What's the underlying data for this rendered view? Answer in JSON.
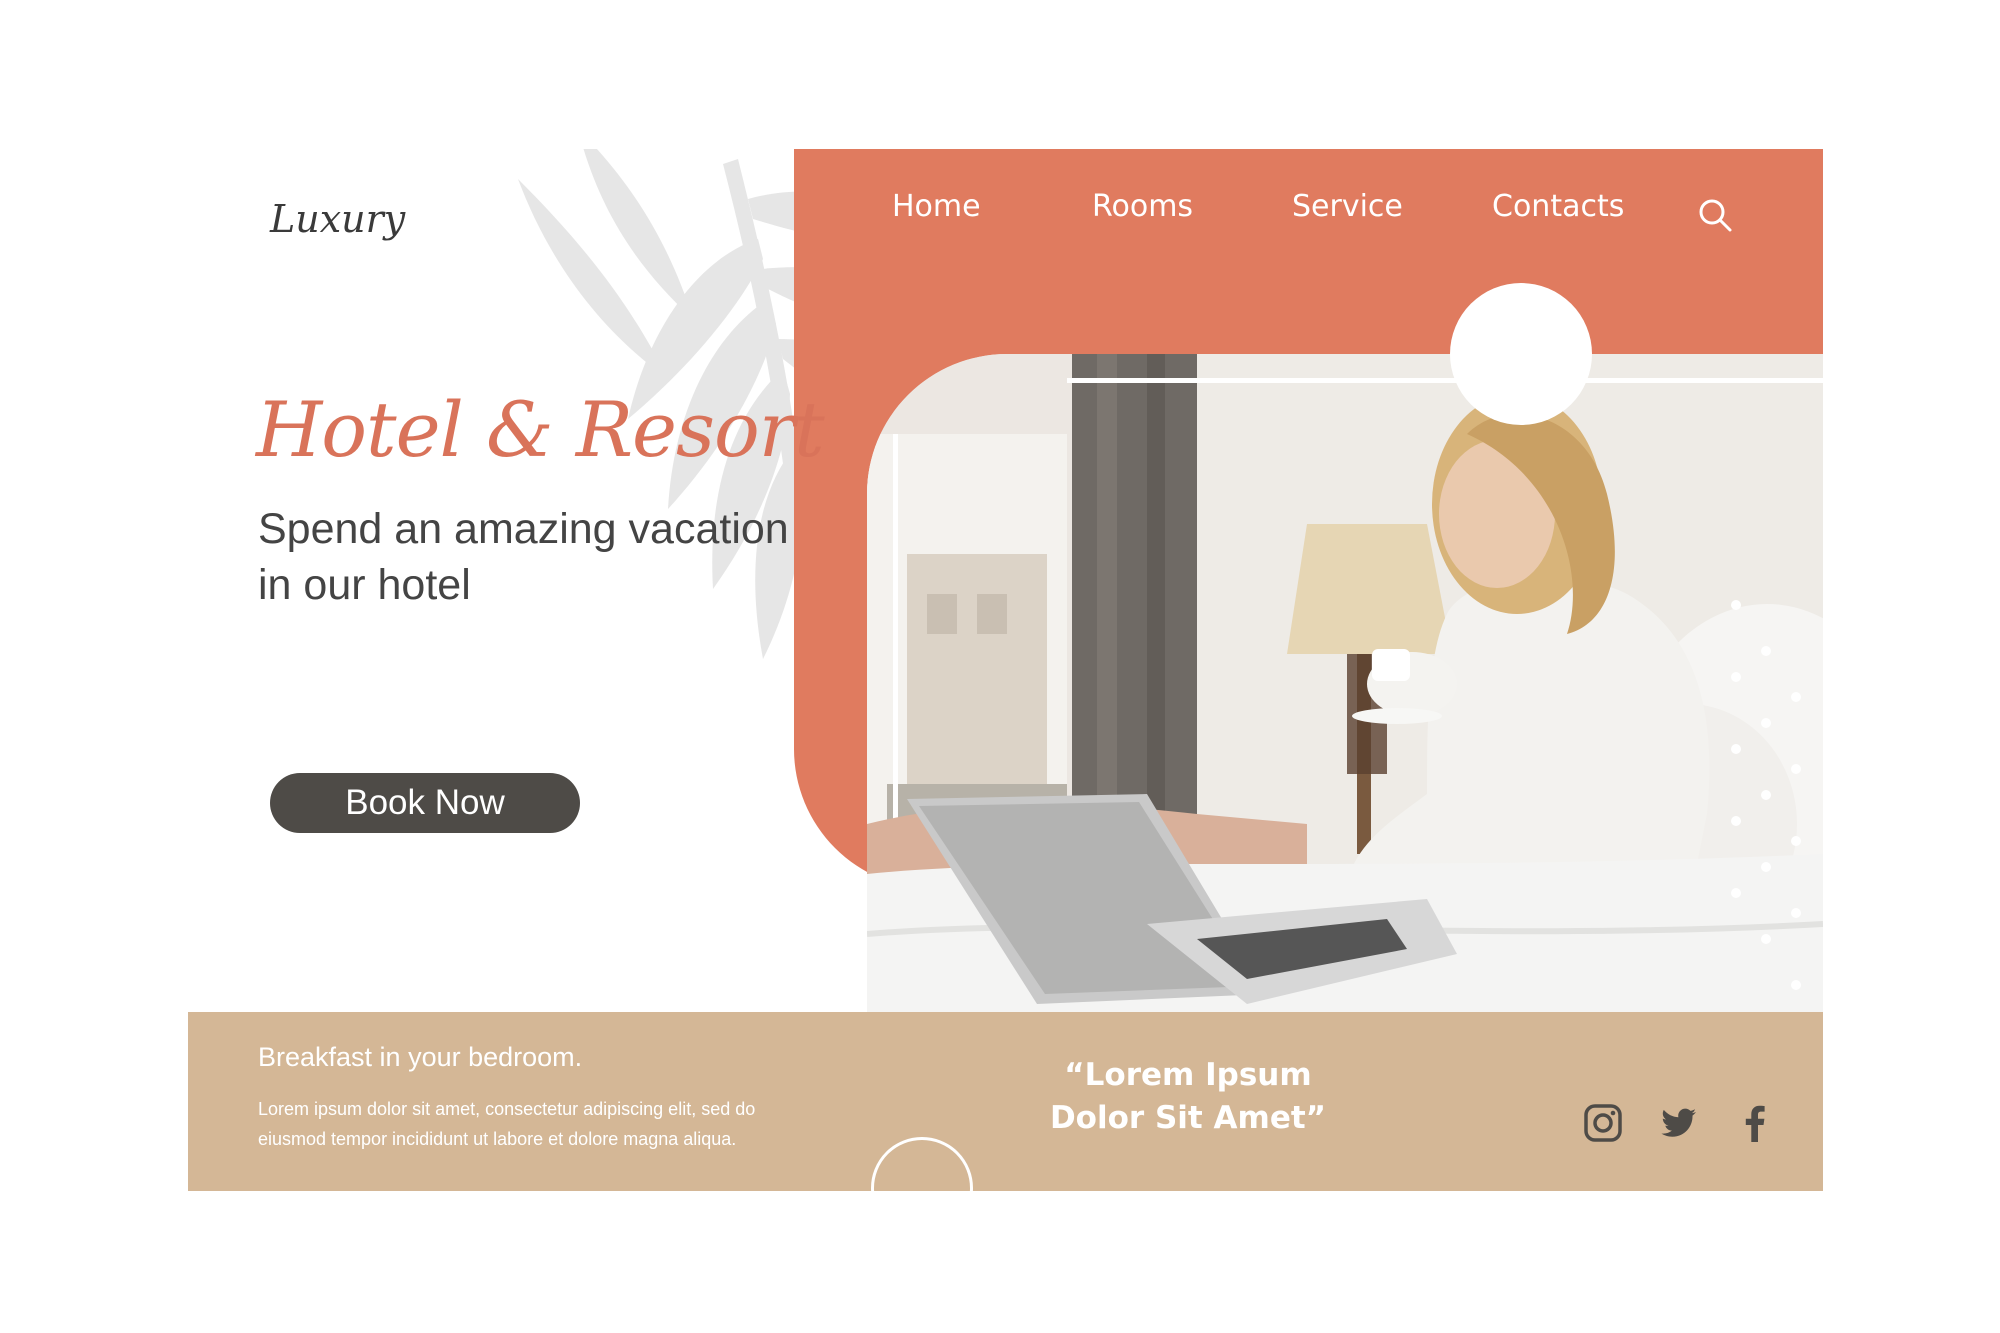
{
  "brand": {
    "logo": "Luxury"
  },
  "nav": {
    "items": [
      {
        "label": "Home"
      },
      {
        "label": "Rooms"
      },
      {
        "label": "Service"
      },
      {
        "label": "Contacts"
      }
    ],
    "search_icon": "search-icon"
  },
  "hero": {
    "headline": "Hotel & Resort",
    "subline": "Spend an amazing vacation in our hotel",
    "cta_label": "Book Now",
    "image": "woman-in-bathrobe-with-laptop-on-bed"
  },
  "footer": {
    "title": "Breakfast in your bedroom.",
    "text": "Lorem ipsum dolor sit amet, consectetur adipiscing elit, sed do eiusmod tempor incididunt ut labore et dolore magna aliqua.",
    "quote_line1": "“Lorem Ipsum",
    "quote_line2": "Dolor Sit Amet”",
    "social": [
      "instagram-icon",
      "twitter-icon",
      "facebook-icon"
    ]
  },
  "colors": {
    "accent": "#e07b5f",
    "headline": "#d9735a",
    "button": "#4e4b47",
    "footer": "#d4b796",
    "text": "#444444"
  }
}
